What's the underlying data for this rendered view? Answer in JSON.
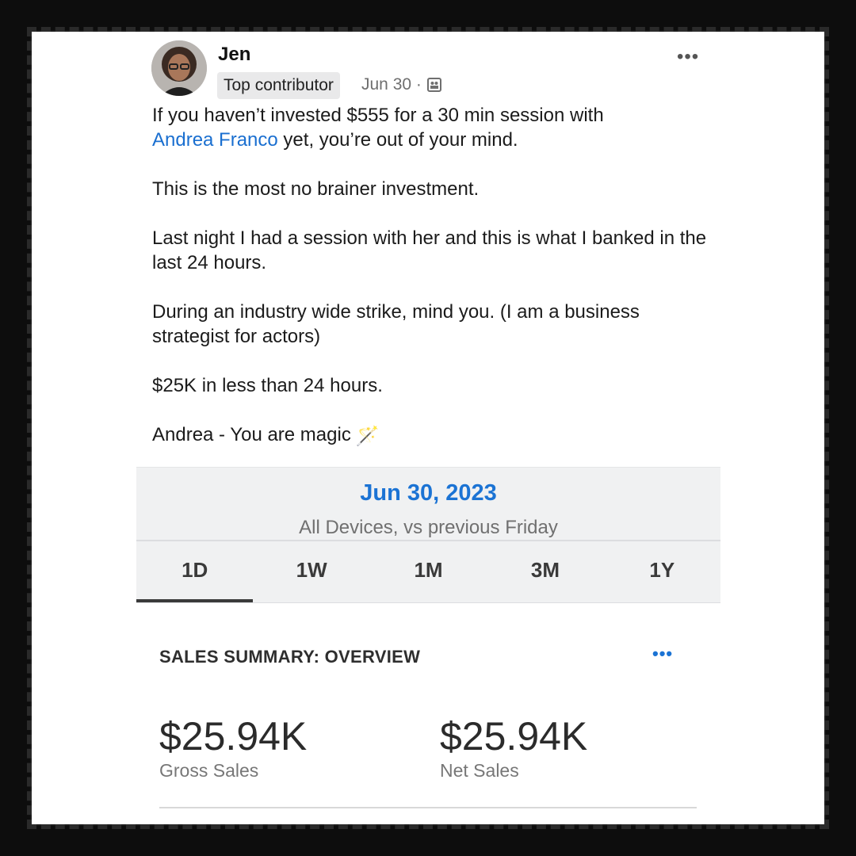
{
  "post": {
    "author": "Jen",
    "badge": "Top contributor",
    "date": "Jun 30 ·",
    "paragraphs": {
      "p1_prefix": "If you haven’t invested $555 for a 30 min session with",
      "mention": "Andrea Franco",
      "p1_suffix": " yet, you’re out of your mind.",
      "p2": "This is the most no brainer investment.",
      "p3": "Last night I had a session with her and this is what I banked in the last 24 hours.",
      "p4": "During an industry wide strike, mind you. (I am a business strategist for actors)",
      "p5": "$25K in less than 24 hours.",
      "p6": "Andrea - You are magic",
      "p6_emoji": "🪄"
    },
    "more_icon": "more-horizontal-icon",
    "more_label": "•••"
  },
  "app": {
    "date": "Jun 30, 2023",
    "subtitle": "All Devices, vs previous Friday",
    "tabs": [
      "1D",
      "1W",
      "1M",
      "3M",
      "1Y"
    ],
    "active_tab": "1D",
    "section_title": "SALES SUMMARY: OVERVIEW",
    "section_more": "•••",
    "metrics": [
      {
        "value": "$25.94K",
        "label": "Gross Sales"
      },
      {
        "value": "$25.94K",
        "label": "Net Sales"
      }
    ]
  },
  "colors": {
    "link": "#1a6fd0",
    "accent": "#1b73d4",
    "frame": "#0d0d0d"
  }
}
